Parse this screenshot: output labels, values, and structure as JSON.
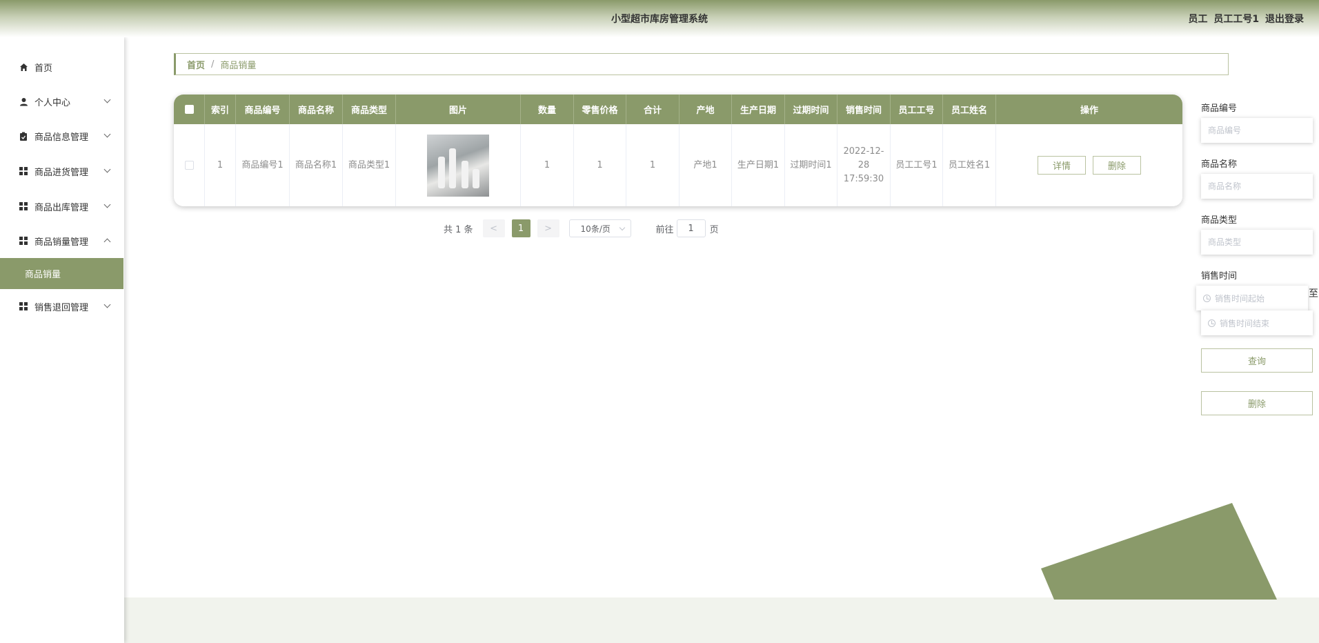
{
  "header": {
    "title": "小型超市库房管理系统",
    "role": "员工",
    "user": "员工工号1",
    "logout": "退出登录"
  },
  "sidebar": {
    "items": [
      {
        "label": "首页",
        "icon": "home-icon"
      },
      {
        "label": "个人中心",
        "icon": "user-icon"
      },
      {
        "label": "商品信息管理",
        "icon": "clipboard-icon"
      },
      {
        "label": "商品进货管理",
        "icon": "grid-icon"
      },
      {
        "label": "商品出库管理",
        "icon": "grid-icon"
      },
      {
        "label": "商品销量管理",
        "icon": "grid-icon"
      },
      {
        "label": "销售退回管理",
        "icon": "grid-icon"
      }
    ],
    "active_sub": "商品销量"
  },
  "breadcrumb": {
    "home": "首页",
    "separator": "/",
    "current": "商品销量"
  },
  "table": {
    "columns": [
      "索引",
      "商品编号",
      "商品名称",
      "商品类型",
      "图片",
      "数量",
      "零售价格",
      "合计",
      "产地",
      "生产日期",
      "过期时间",
      "销售时间",
      "员工工号",
      "员工姓名",
      "操作"
    ],
    "rows": [
      {
        "index": "1",
        "code": "商品编号1",
        "name": "商品名称1",
        "type": "商品类型1",
        "qty": "1",
        "price": "1",
        "total": "1",
        "origin": "产地1",
        "produce_date": "生产日期1",
        "expire": "过期时间1",
        "sale_time": "2022-12-28 17:59:30",
        "emp_no": "员工工号1",
        "emp_name": "员工姓名1",
        "detail_label": "详情",
        "delete_label": "删除"
      }
    ]
  },
  "pagination": {
    "total_text": "共 1 条",
    "prev": "<",
    "current": "1",
    "next": ">",
    "page_size": "10条/页",
    "goto_label": "前往",
    "goto_value": "1",
    "page_unit": "页"
  },
  "search": {
    "code_label": "商品编号",
    "code_placeholder": "商品编号",
    "name_label": "商品名称",
    "name_placeholder": "商品名称",
    "type_label": "商品类型",
    "type_placeholder": "商品类型",
    "time_label": "销售时间",
    "time_start_placeholder": "销售时间起始",
    "time_to": "至",
    "time_end_placeholder": "销售时间结束",
    "query_label": "查询",
    "delete_label": "删除"
  },
  "colors": {
    "primary": "#8a9a6a",
    "band": "#f1f3ed"
  }
}
